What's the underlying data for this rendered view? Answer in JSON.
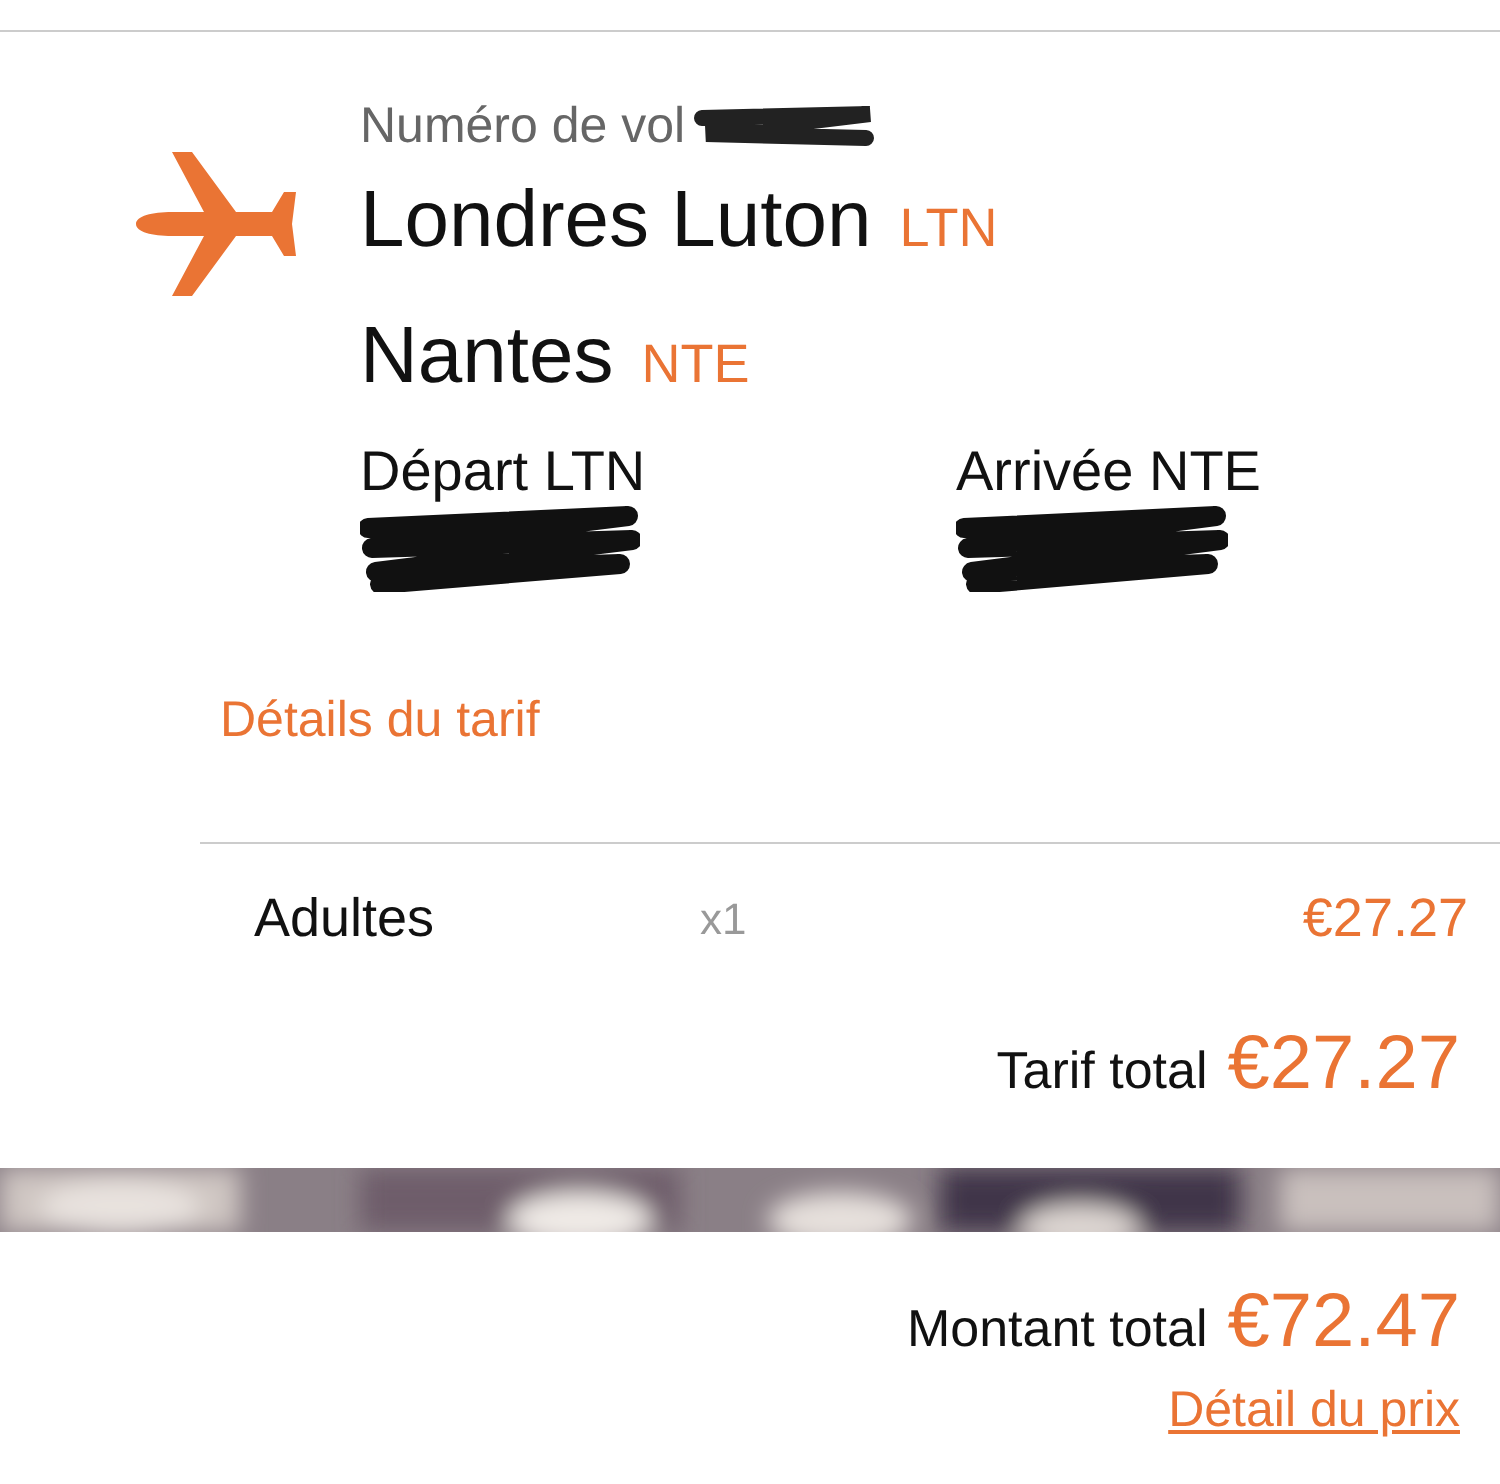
{
  "flight": {
    "number_label": "Numéro de vol",
    "origin": {
      "city": "Londres Luton",
      "code": "LTN"
    },
    "destination": {
      "city": "Nantes",
      "code": "NTE"
    },
    "departure_label": "Départ LTN",
    "arrival_label": "Arrivée NTE",
    "fare_details_link": "Détails du tarif"
  },
  "fare_rows": [
    {
      "label": "Adultes",
      "quantity": "x1",
      "price": "€27.27"
    }
  ],
  "fare_total": {
    "label": "Tarif total",
    "amount": "€27.27"
  },
  "grand_total": {
    "label": "Montant total",
    "amount": "€72.47",
    "link": "Détail du prix"
  }
}
